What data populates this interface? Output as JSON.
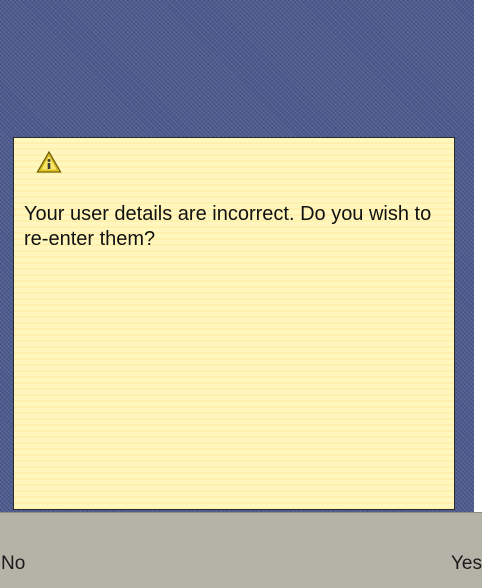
{
  "dialog": {
    "icon": "warning-triangle-icon",
    "message": "Your user details are incorrect. Do you wish to re-enter them?"
  },
  "softkeys": {
    "left_label": "No",
    "right_label": "Yes"
  },
  "colors": {
    "backdrop": "#4c5a8c",
    "dialog_background": "#fff6b8",
    "softkey_bar": "#b5b2a8",
    "warning_icon_fill": "#f2d21e"
  }
}
